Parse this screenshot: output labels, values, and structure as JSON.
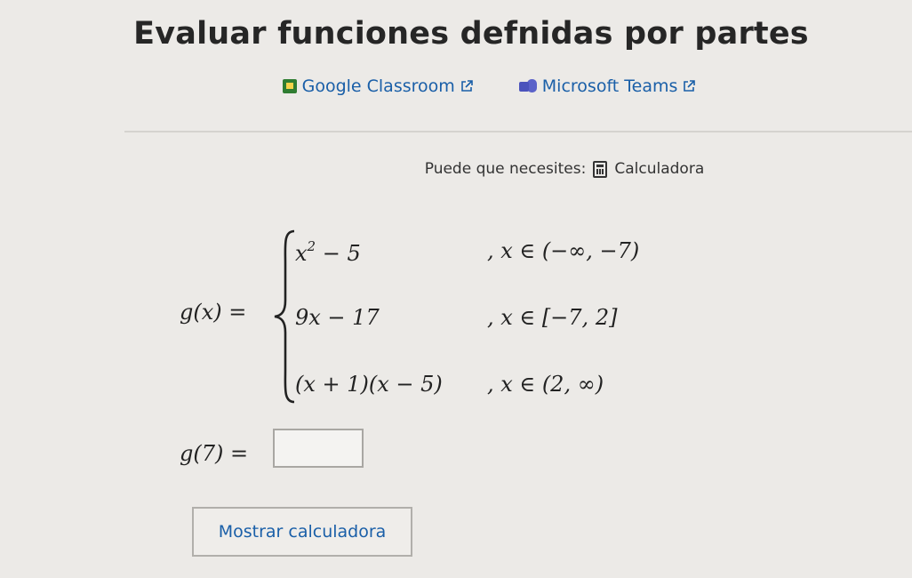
{
  "header": {
    "title": "Evaluar funciones defnidas por partes"
  },
  "share": {
    "google_label": "Google Classroom",
    "teams_label": "Microsoft Teams"
  },
  "tools": {
    "prefix": "Puede que necesites:",
    "calculator_label": "Calculadora"
  },
  "problem": {
    "function_lhs": "g(x) =",
    "cases": [
      {
        "expr_base": "x",
        "expr_sup": "2",
        "expr_rest": " − 5",
        "domain": ",   x ∈ (−∞, −7)"
      },
      {
        "expr": "9x − 17",
        "domain": ",   x ∈ [−7, 2]"
      },
      {
        "expr": "(x + 1)(x − 5)",
        "domain": ",   x ∈ (2, ∞)"
      }
    ],
    "question": "g(7) =",
    "answer_value": ""
  },
  "actions": {
    "show_calculator": "Mostrar calculadora"
  },
  "colors": {
    "link": "#1a5fa8",
    "background": "#eceae7"
  }
}
